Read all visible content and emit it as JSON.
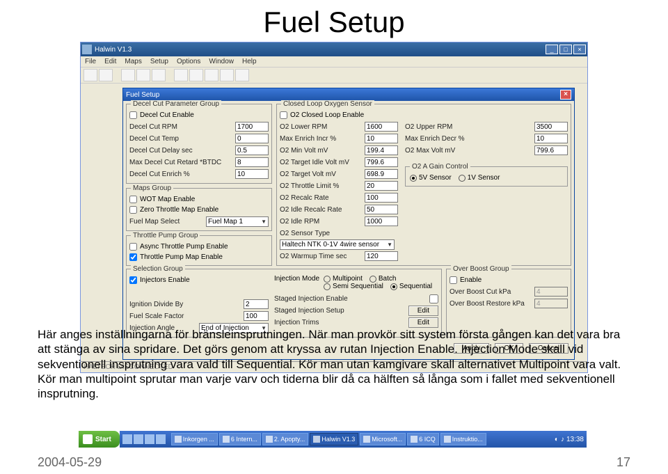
{
  "slide": {
    "title": "Fuel Setup",
    "body_text": "Här anges inställningarna för bränsleinsprutningen. När man provkör sitt system första gången kan det vara bra att stänga av sina spridare. Det görs genom att kryssa av rutan Injection Enable. Injection Mode skall vid sekventionell insprutning vara vald till Sequential. Kör man utan kamgivare skall alternativet Multipoint vara valt. Kör man multipoint sprutar man varje varv och tiderna blir då ca hälften så långa som i fallet med sekventionell insprutning.",
    "date": "2004-05-29",
    "page": "17"
  },
  "app": {
    "title": "Halwin V1.3",
    "menu": [
      "File",
      "Edit",
      "Maps",
      "Setup",
      "Options",
      "Window",
      "Help"
    ],
    "status": "HALTECH DISCONNECTED"
  },
  "dlg": {
    "title": "Fuel Setup",
    "decel": {
      "title": "Decel Cut Parameter Group",
      "enable_label": "Decel Cut Enable",
      "rpm_label": "Decel Cut RPM",
      "rpm_val": "1700",
      "temp_label": "Decel Cut Temp",
      "temp_val": "0",
      "delay_label": "Decel Cut Delay sec",
      "delay_val": "0.5",
      "retard_label": "Max Decel Cut Retard *BTDC",
      "retard_val": "8",
      "enrich_label": "Decel Cut Enrich %",
      "enrich_val": "10"
    },
    "maps": {
      "title": "Maps Group",
      "wot_label": "WOT Map Enable",
      "zero_label": "Zero Throttle Map Enable",
      "fms_label": "Fuel Map Select",
      "fms_val": "Fuel Map 1"
    },
    "tpump": {
      "title": "Throttle Pump Group",
      "async_label": "Async Throttle Pump Enable",
      "map_label": "Throttle Pump Map Enable"
    },
    "o2": {
      "title": "Closed Loop Oxygen Sensor",
      "enable_label": "O2 Closed Loop Enable",
      "lower_rpm_label": "O2 Lower RPM",
      "lower_rpm_val": "1600",
      "upper_rpm_label": "O2 Upper RPM",
      "upper_rpm_val": "3500",
      "max_incr_label": "Max Enrich Incr %",
      "max_incr_val": "10",
      "max_decr_label": "Max Enrich Decr %",
      "max_decr_val": "10",
      "min_mv_label": "O2 Min Volt mV",
      "min_mv_val": "199.4",
      "max_mv_label": "O2 Max Volt mV",
      "max_mv_val": "799.6",
      "idle_mv_label": "O2 Target Idle Volt mV",
      "idle_mv_val": "799.6",
      "tgt_mv_label": "O2 Target Volt mV",
      "tgt_mv_val": "698.9",
      "thr_lim_label": "O2 Throttle Limit %",
      "thr_lim_val": "20",
      "recalc_label": "O2 Recalc Rate",
      "recalc_val": "100",
      "idle_recalc_label": "O2 Idle Recalc Rate",
      "idle_recalc_val": "50",
      "idle_rpm_label": "O2 Idle RPM",
      "idle_rpm_val": "1000",
      "sensor_type_label": "O2 Sensor Type",
      "sensor_type_val": "Haltech NTK 0-1V 4wire sensor",
      "warmup_label": "O2 Warmup Time sec",
      "warmup_val": "120",
      "gain_title": "O2 A Gain Control",
      "gain_5v": "5V Sensor",
      "gain_1v": "1V Sensor"
    },
    "sel": {
      "title": "Selection Group",
      "inj_enable_label": "Injectors Enable",
      "mode_label": "Injection Mode",
      "mode_multi": "Multipoint",
      "mode_batch": "Batch",
      "mode_semi": "Semi Sequential",
      "mode_seq": "Sequential",
      "ign_div_label": "Ignition Divide By",
      "ign_div_val": "2",
      "staged_enable_label": "Staged Injection Enable",
      "scale_label": "Fuel Scale Factor",
      "scale_val": "100",
      "staged_setup_label": "Staged Injection Setup",
      "angle_label": "Injection Angle",
      "angle_val": "End of Injection",
      "trims_label": "Injection Trims",
      "edit": "Edit"
    },
    "boost": {
      "title": "Over Boost Group",
      "enable_label": "Enable",
      "cut_label": "Over Boost Cut kPa",
      "cut_val": "4",
      "restore_label": "Over Boost Restore kPa",
      "restore_val": "4"
    },
    "footer": {
      "apply": "Apply",
      "ok": "OK",
      "cancel": "Cancel"
    }
  },
  "taskbar": {
    "start": "Start",
    "items": [
      "Inkorgen ...",
      "6 Intern...",
      "2. Apopty...",
      "Halwin V1.3",
      "Microsoft...",
      "6 ICQ",
      "Instruktio..."
    ],
    "time": "13:38"
  }
}
